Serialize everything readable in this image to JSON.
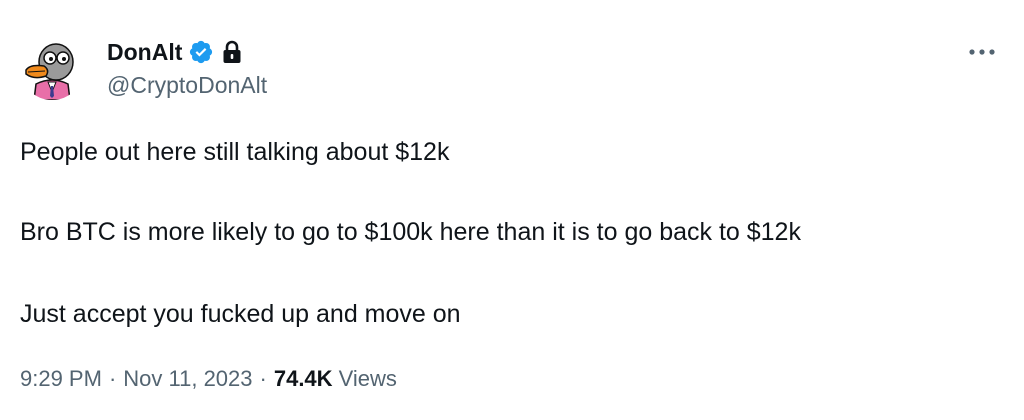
{
  "colors": {
    "verified": "#1d9bf0",
    "secondary_text": "#536471",
    "primary_text": "#0f1419",
    "avatar_suit": "#e86fa8"
  },
  "author": {
    "name": "DonAlt",
    "handle": "@CryptoDonAlt",
    "verified_icon": "verified-badge-icon",
    "protected_icon": "lock-icon"
  },
  "menu_icon": "more-options-icon",
  "tweet": {
    "lines": [
      "People out here still talking about $12k",
      "Bro BTC is more likely to go to $100k here than it is to go back to $12k",
      "Just accept you fucked up and move on"
    ]
  },
  "meta": {
    "time": "9:29 PM",
    "separator": "·",
    "date": "Nov 11, 2023",
    "views_count": "74.4K",
    "views_label": "Views"
  }
}
